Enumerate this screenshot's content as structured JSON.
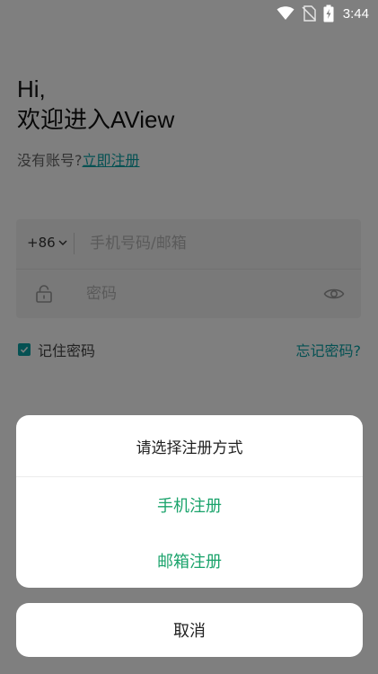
{
  "status_bar": {
    "time": "3:44",
    "icons": [
      "wifi-icon",
      "no-sim-icon",
      "battery-charging-icon"
    ]
  },
  "login": {
    "greeting_line1": "Hi,",
    "greeting_line2": "欢迎进入AView",
    "no_account_text": "没有账号?",
    "register_link": "立即注册",
    "country_code": "+86",
    "phone_placeholder": "手机号码/邮箱",
    "password_placeholder": "密码",
    "remember_label": "记住密码",
    "remember_checked": true,
    "forgot_password": "忘记密码?"
  },
  "register_sheet": {
    "title": "请选择注册方式",
    "options": [
      "手机注册",
      "邮箱注册"
    ],
    "cancel": "取消"
  },
  "colors": {
    "accent": "#0aa3a7",
    "option_green": "#1aa36b",
    "overlay": "rgba(0,0,0,0.5)"
  }
}
